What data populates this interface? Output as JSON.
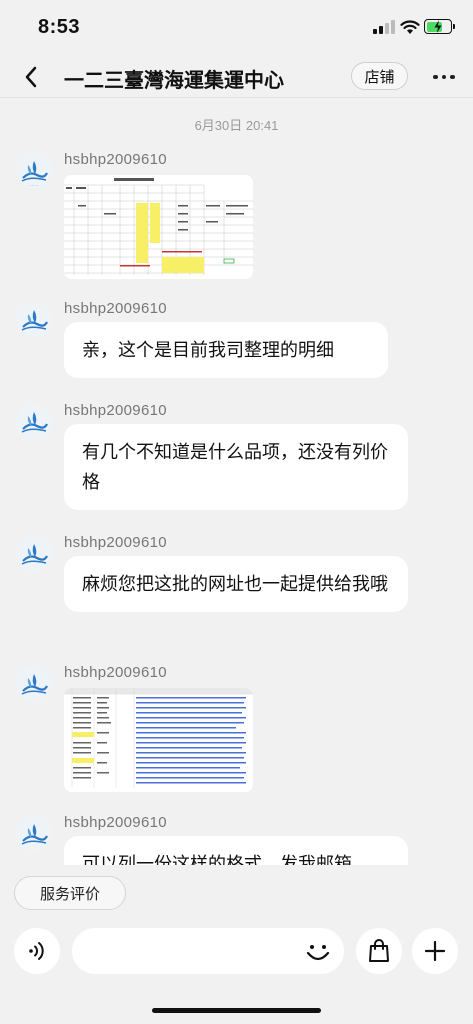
{
  "status_bar": {
    "time": "8:53"
  },
  "header": {
    "title": "一二三臺灣海運集運中心",
    "store_label": "店铺"
  },
  "chat": {
    "timestamp": "6月30日 20:41",
    "messages": [
      {
        "sender": "hsbhp2009610",
        "type": "image",
        "image_label": "spreadsheet-screenshot"
      },
      {
        "sender": "hsbhp2009610",
        "type": "text",
        "text": "亲，这个是目前我司整理的明细"
      },
      {
        "sender": "hsbhp2009610",
        "type": "text",
        "text": "有几个不知道是什么品项，还没有列价格"
      },
      {
        "sender": "hsbhp2009610",
        "type": "text",
        "text": "麻烦您把这批的网址也一起提供给我哦"
      },
      {
        "sender": "hsbhp2009610",
        "type": "image",
        "image_label": "spreadsheet-screenshot"
      },
      {
        "sender": "hsbhp2009610",
        "type": "text",
        "text": "可以列一份这样的格式，发我邮箱"
      }
    ]
  },
  "bottom_bar": {
    "rating_label": "服务评价",
    "input_placeholder": ""
  },
  "colors": {
    "background": "#f1f1f1",
    "bubble": "#ffffff",
    "battery_charge": "#4cd964"
  },
  "battery_level": 0.7
}
